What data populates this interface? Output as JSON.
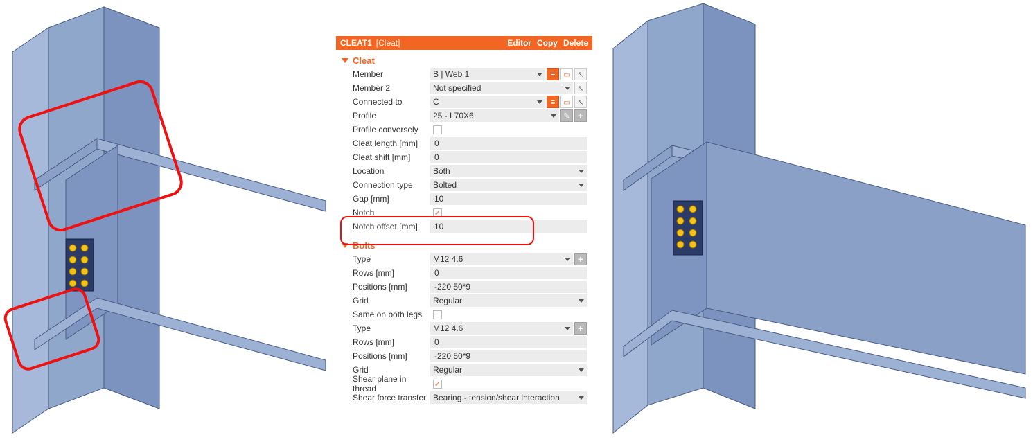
{
  "header": {
    "title": "CLEAT1",
    "subtitle": "[Cleat]",
    "actions": {
      "editor": "Editor",
      "copy": "Copy",
      "delete": "Delete"
    }
  },
  "sections": {
    "cleat": {
      "title": "Cleat",
      "rows": {
        "member": {
          "label": "Member",
          "value": "B | Web 1",
          "type": "dropdown",
          "buttons": [
            "orange-bars",
            "frame",
            "arrow"
          ]
        },
        "member2": {
          "label": "Member 2",
          "value": "Not specified",
          "type": "dropdown",
          "buttons": [
            "arrow"
          ]
        },
        "connected_to": {
          "label": "Connected to",
          "value": "C",
          "type": "dropdown",
          "buttons": [
            "orange-bars",
            "frame",
            "arrow"
          ]
        },
        "profile": {
          "label": "Profile",
          "value": "25 - L70X6",
          "type": "dropdown",
          "buttons": [
            "pencil",
            "plus"
          ]
        },
        "profile_conv": {
          "label": "Profile conversely",
          "value": false,
          "type": "check"
        },
        "cleat_length": {
          "label": "Cleat length [mm]",
          "value": "0",
          "type": "text"
        },
        "cleat_shift": {
          "label": "Cleat shift [mm]",
          "value": "0",
          "type": "text"
        },
        "location": {
          "label": "Location",
          "value": "Both",
          "type": "dropdown"
        },
        "conn_type": {
          "label": "Connection type",
          "value": "Bolted",
          "type": "dropdown"
        },
        "gap": {
          "label": "Gap [mm]",
          "value": "10",
          "type": "text"
        },
        "notch": {
          "label": "Notch",
          "value": true,
          "type": "check"
        },
        "notch_offset": {
          "label": "Notch offset [mm]",
          "value": "10",
          "type": "text"
        }
      }
    },
    "bolts": {
      "title": "Bolts",
      "rows": {
        "type1": {
          "label": "Type",
          "value": "M12 4.6",
          "type": "dropdown",
          "buttons": [
            "plus"
          ]
        },
        "rows1": {
          "label": "Rows [mm]",
          "value": "0",
          "type": "text"
        },
        "pos1": {
          "label": "Positions [mm]",
          "value": "-220 50*9",
          "type": "text"
        },
        "grid1": {
          "label": "Grid",
          "value": "Regular",
          "type": "dropdown"
        },
        "both_legs": {
          "label": "Same on both legs",
          "value": false,
          "type": "check"
        },
        "type2": {
          "label": "Type",
          "value": "M12 4.6",
          "type": "dropdown",
          "buttons": [
            "plus"
          ]
        },
        "rows2": {
          "label": "Rows [mm]",
          "value": "0",
          "type": "text"
        },
        "pos2": {
          "label": "Positions [mm]",
          "value": "-220 50*9",
          "type": "text"
        },
        "grid2": {
          "label": "Grid",
          "value": "Regular",
          "type": "dropdown"
        },
        "shear_thr": {
          "label": "Shear plane in thread",
          "value": true,
          "type": "check"
        },
        "shear_ft": {
          "label": "Shear force transfer",
          "value": "Bearing - tension/shear interaction",
          "type": "dropdown"
        }
      }
    }
  }
}
